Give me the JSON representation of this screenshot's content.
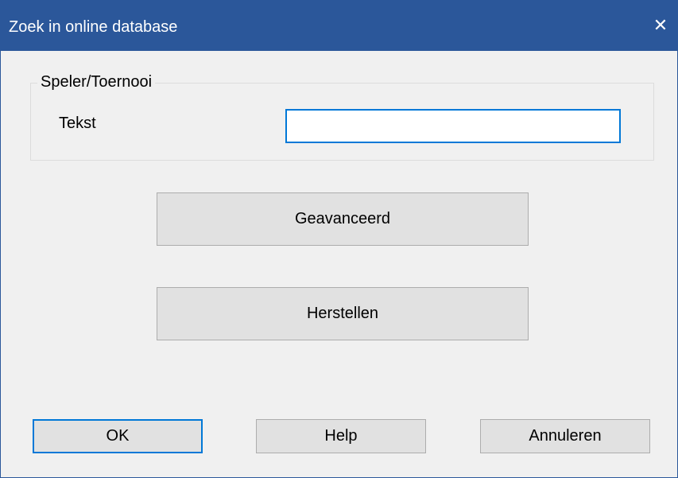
{
  "window": {
    "title": "Zoek in online database",
    "close_glyph": "✕"
  },
  "group": {
    "legend": "Speler/Toernooi",
    "text_label": "Tekst",
    "text_value": ""
  },
  "buttons": {
    "advanced": "Geavanceerd",
    "reset": "Herstellen",
    "ok": "OK",
    "help": "Help",
    "cancel": "Annuleren"
  },
  "colors": {
    "titlebar": "#2b579a",
    "focus": "#0078d7",
    "button_face": "#e1e1e1",
    "dialog_bg": "#f0f0f0"
  }
}
